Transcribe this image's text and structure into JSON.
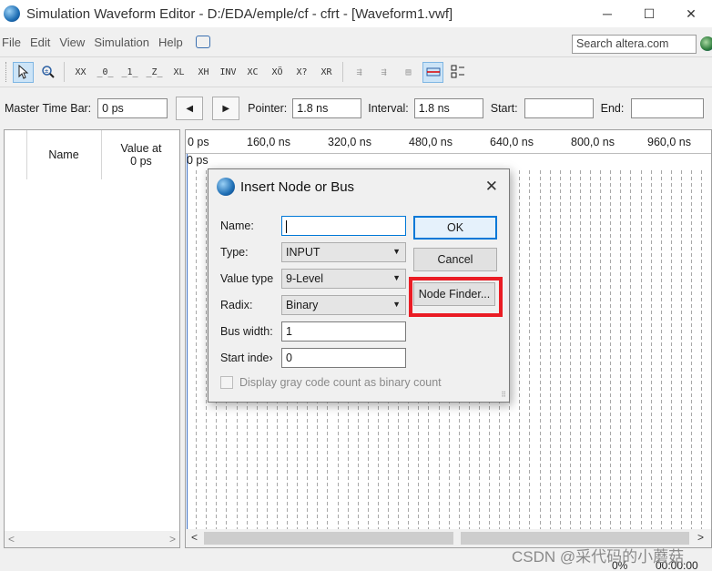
{
  "window": {
    "title": "Simulation Waveform Editor - D:/EDA/emple/cf - cfrt - [Waveform1.vwf]",
    "minimize": "─",
    "maximize": "☐",
    "close": "✕"
  },
  "menu": {
    "file": "File",
    "edit": "Edit",
    "view": "View",
    "simulation": "Simulation",
    "help": "Help"
  },
  "search": {
    "placeholder": "Search altera.com"
  },
  "toolbar": {
    "icons": [
      "selection-tool",
      "zoom-tool",
      "forcing-unknown",
      "forcing-low",
      "forcing-high",
      "high-impedance",
      "weak-low",
      "weak-high",
      "invert",
      "count-value",
      "clock",
      "forcing-value",
      "random-value",
      "run-functional-simulation",
      "run-timing-simulation",
      "generate-netlist",
      "snap-to-grid",
      "sort-by-name"
    ]
  },
  "timebar": {
    "master_label": "Master Time Bar:",
    "master_value": "0 ps",
    "prev": "◀",
    "next": "▶",
    "pointer_label": "Pointer:",
    "pointer_value": "1.8 ns",
    "interval_label": "Interval:",
    "interval_value": "1.8 ns",
    "start_label": "Start:",
    "start_value": "",
    "end_label": "End:",
    "end_value": ""
  },
  "left_pane": {
    "name_header": "Name",
    "value_header_line1": "Value at",
    "value_header_line2": "0 ps",
    "scroll_left": "<",
    "scroll_right": ">"
  },
  "ruler": {
    "ticks": [
      "0 ps",
      "160,0 ns",
      "320,0 ns",
      "480,0 ns",
      "640,0 ns",
      "800,0 ns",
      "960,0 ns"
    ],
    "marker": "0 ps"
  },
  "wave_scroll": {
    "left": "<",
    "right": ">"
  },
  "status": {
    "progress": "0%",
    "time": "00:00:00"
  },
  "watermark": "CSDN @采代码的小蘑菇",
  "dialog": {
    "title": "Insert Node or Bus",
    "close": "✕",
    "name_label": "Name:",
    "name_value": "",
    "type_label": "Type:",
    "type_value": "INPUT",
    "value_type_label": "Value type",
    "value_type_value": "9-Level",
    "radix_label": "Radix:",
    "radix_value": "Binary",
    "bus_width_label": "Bus width:",
    "bus_width_value": "1",
    "start_index_label": "Start inde›",
    "start_index_value": "0",
    "ok": "OK",
    "cancel": "Cancel",
    "node_finder": "Node Finder...",
    "gray_code": "Display gray code count as binary count",
    "highlight_color": "#ea1c24"
  }
}
